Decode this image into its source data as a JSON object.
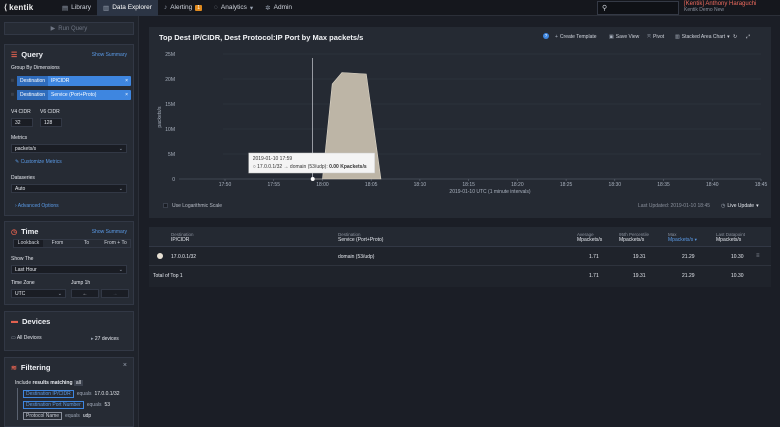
{
  "nav": {
    "logo_text": "kentik",
    "items": [
      {
        "label": "Library",
        "icon": "book-icon"
      },
      {
        "label": "Data Explorer",
        "icon": "chart-icon"
      },
      {
        "label": "Alerting",
        "icon": "bell-icon",
        "badge": "1"
      },
      {
        "label": "Analytics",
        "icon": "bulb-icon",
        "chevron": "▾"
      },
      {
        "label": "Admin",
        "icon": "gear-icon"
      }
    ],
    "user_name": "[Kentik] Anthony Haraguchi",
    "user_org": "Kentik Demo New"
  },
  "sidebar": {
    "run_query_label": "Run Query",
    "query": {
      "title": "Query",
      "show_summary": "Show Summary",
      "group_by_label": "Group By Dimensions",
      "dimensions": [
        {
          "tag": "Destination",
          "value": "IP/CIDR"
        },
        {
          "tag": "Destination",
          "value": "Service (Port+Proto)"
        }
      ],
      "v4_label": "V4 CIDR",
      "v6_label": "V6 CIDR",
      "v4_value": "32",
      "v6_value": "128",
      "metrics_label": "Metrics",
      "metrics_value": "packets/s",
      "customize_metrics": "Customize Metrics",
      "dataseries_label": "Dataseries",
      "dataseries_value": "Auto",
      "advanced_options": "Advanced Options"
    },
    "time": {
      "title": "Time",
      "show_summary": "Show Summary",
      "segments": [
        "Lookback",
        "From",
        "To",
        "From + To"
      ],
      "show_the_label": "Show The",
      "show_the_value": "Last Hour",
      "timezone_label": "Time Zone",
      "timezone_value": "UTC",
      "jump_label": "Jump 1h",
      "jump_back": "←",
      "jump_fwd": "→"
    },
    "devices": {
      "title": "Devices",
      "all_devices": "All Devices",
      "count": "27 devices"
    },
    "filtering": {
      "title": "Filtering",
      "include_prefix": "Include",
      "include_bold": "results matching",
      "include_mode": "all",
      "rules": [
        {
          "field": "Destination IP/CIDR",
          "op": "equals",
          "value": "17.0.0.1/32"
        },
        {
          "field": "Destination Port Number",
          "op": "equals",
          "value": "53"
        },
        {
          "field": "Protocol Name",
          "op": "equals",
          "value": "udp"
        }
      ]
    }
  },
  "main": {
    "title": "Top Dest IP/CIDR, Dest Protocol:IP Port by Max packets/s",
    "toolbar": {
      "help": "?",
      "create_template": "Create Template",
      "save_view": "Save View",
      "pivot": "Pivot",
      "chart_type": "Stacked Area Chart"
    },
    "tooltip": {
      "time": "2019-01-10 17:59",
      "line": "17.0.0.1/32 → domain (53/udp):",
      "value": "0.00 Kpackets/s"
    },
    "log_scale_label": "Use Logarithmic Scale",
    "last_updated": "Last Updated: 2019-01-10 18:45",
    "live_update": "Live Update"
  },
  "chart_data": {
    "type": "area",
    "ylabel": "packets/s",
    "xlabel": "2019-01-10 UTC (1 minute intervals)",
    "y_ticks": [
      "0",
      "5M",
      "10M",
      "15M",
      "20M",
      "25M"
    ],
    "ylim": [
      0,
      25000000
    ],
    "x_ticks": [
      "17:50",
      "17:55",
      "18:00",
      "18:05",
      "18:10",
      "18:15",
      "18:20",
      "18:25",
      "18:30",
      "18:35",
      "18:40",
      "18:45"
    ],
    "x_minutes": [
      0,
      5,
      10,
      15,
      20,
      25,
      30,
      35,
      40,
      45,
      50,
      55
    ],
    "series": [
      {
        "name": "17.0.0.1/32 → domain (53/udp)",
        "color": "#bdb5a6",
        "points": [
          {
            "t": 9,
            "v": 0
          },
          {
            "t": 10,
            "v": 0
          },
          {
            "t": 11,
            "v": 19000000
          },
          {
            "t": 12,
            "v": 21300000
          },
          {
            "t": 14.5,
            "v": 21000000
          },
          {
            "t": 16,
            "v": 0
          }
        ]
      }
    ],
    "grid": true
  },
  "table": {
    "headers": [
      {
        "sub": "Destination",
        "main": "IP/CIDR"
      },
      {
        "sub": "Destination",
        "main": "Service (Port+Proto)"
      },
      {
        "sub": "Average",
        "main": "Mpackets/s"
      },
      {
        "sub": "95th Percentile",
        "main": "Mpackets/s"
      },
      {
        "sub": "Max",
        "main": "Mpackets/s"
      },
      {
        "sub": "Last Datapoint",
        "main": "Mpackets/s"
      }
    ],
    "sort_arrow": "▾",
    "rows": [
      {
        "ip": "17.0.0.1/32",
        "service": "domain (53/udp)",
        "avg": "1.71",
        "p95": "19.31",
        "max": "21.29",
        "last": "10.30"
      }
    ],
    "total": {
      "label": "Total of Top 1",
      "avg": "1.71",
      "p95": "19.31",
      "max": "21.29",
      "last": "10.30"
    }
  }
}
